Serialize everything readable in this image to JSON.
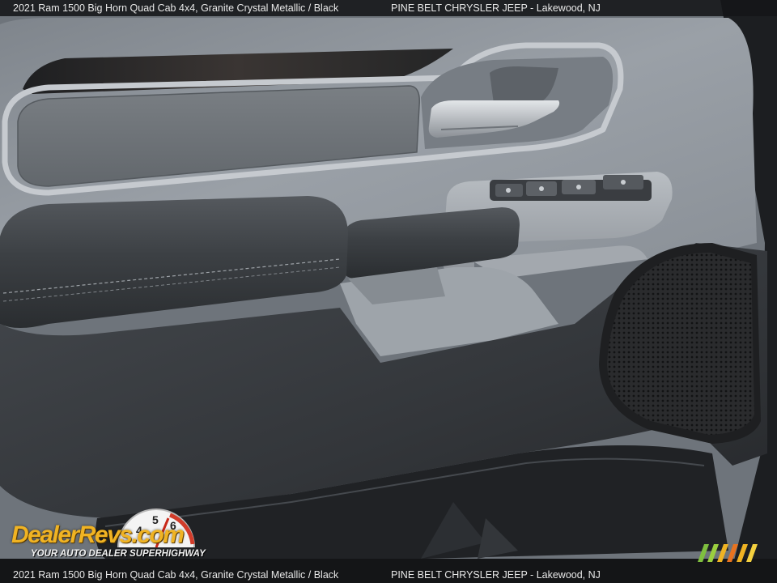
{
  "caption": {
    "vehicle": "2021 Ram 1500 Big Horn Quad Cab 4x4,   Granite Crystal Metallic / Black",
    "dealer": "PINE BELT CHRYSLER JEEP - Lakewood, NJ"
  },
  "watermark": {
    "brand": "DealerRevs.com",
    "tagline": "YOUR AUTO DEALER SUPERHIGHWAY",
    "gauge_numbers": [
      "4",
      "5",
      "6"
    ]
  },
  "colors": {
    "panel_gray": "#8e949b",
    "vinyl_dark": "#3b3e42",
    "lower_panel": "#2f3236",
    "trim_silver": "#c6cacf",
    "logo_gold": "#f0b323"
  },
  "icons": [
    "door-handle-icon",
    "window-switch-icon",
    "speaker-grille-icon",
    "speedometer-icon"
  ]
}
